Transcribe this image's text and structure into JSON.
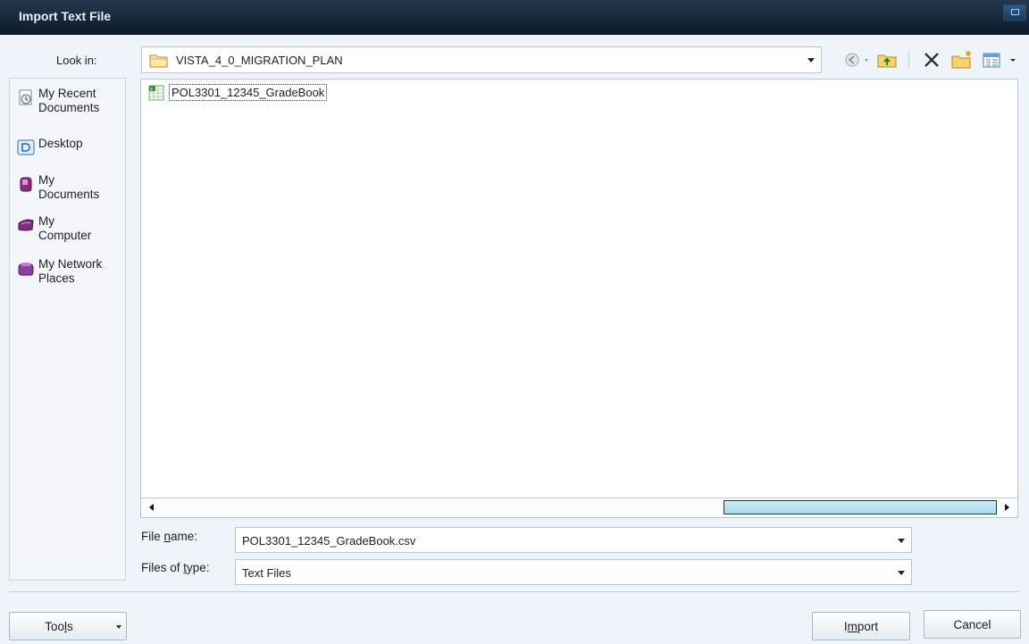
{
  "window": {
    "title": "Import Text File"
  },
  "lookin": {
    "label": "Look in:",
    "value": "VISTA_4_0_MIGRATION_PLAN"
  },
  "toolbar": {
    "icons": [
      "back-icon",
      "up-folder-icon",
      "delete-icon",
      "new-folder-icon",
      "views-icon"
    ]
  },
  "places": [
    {
      "label": "My Recent\nDocuments",
      "icon": "recent-documents-icon"
    },
    {
      "label": "Desktop",
      "icon": "desktop-icon"
    },
    {
      "label": "My\nDocuments",
      "icon": "my-documents-icon"
    },
    {
      "label": "My\nComputer",
      "icon": "my-computer-icon"
    },
    {
      "label": "My Network\nPlaces",
      "icon": "network-places-icon"
    }
  ],
  "files": [
    {
      "name": "POL3301_12345_GradeBook",
      "icon": "csv-file-icon",
      "selected": true
    }
  ],
  "filename": {
    "label_pre": "File ",
    "label_ul": "n",
    "label_post": "ame:",
    "value": "POL3301_12345_GradeBook.csv"
  },
  "filetype": {
    "label_pre": "Files of ",
    "label_ul": "t",
    "label_post": "ype:",
    "value": "Text Files"
  },
  "buttons": {
    "tools_pre": "Too",
    "tools_ul": "l",
    "tools_post": "s",
    "import_pre": "I",
    "import_ul": "m",
    "import_post": "port",
    "cancel": "Cancel"
  },
  "colors": {
    "titlebar": "#17283a",
    "title_text": "#e9f1f8",
    "dialog_bg": "#eef4f9",
    "scroll_thumb": "#b8e3f0"
  }
}
